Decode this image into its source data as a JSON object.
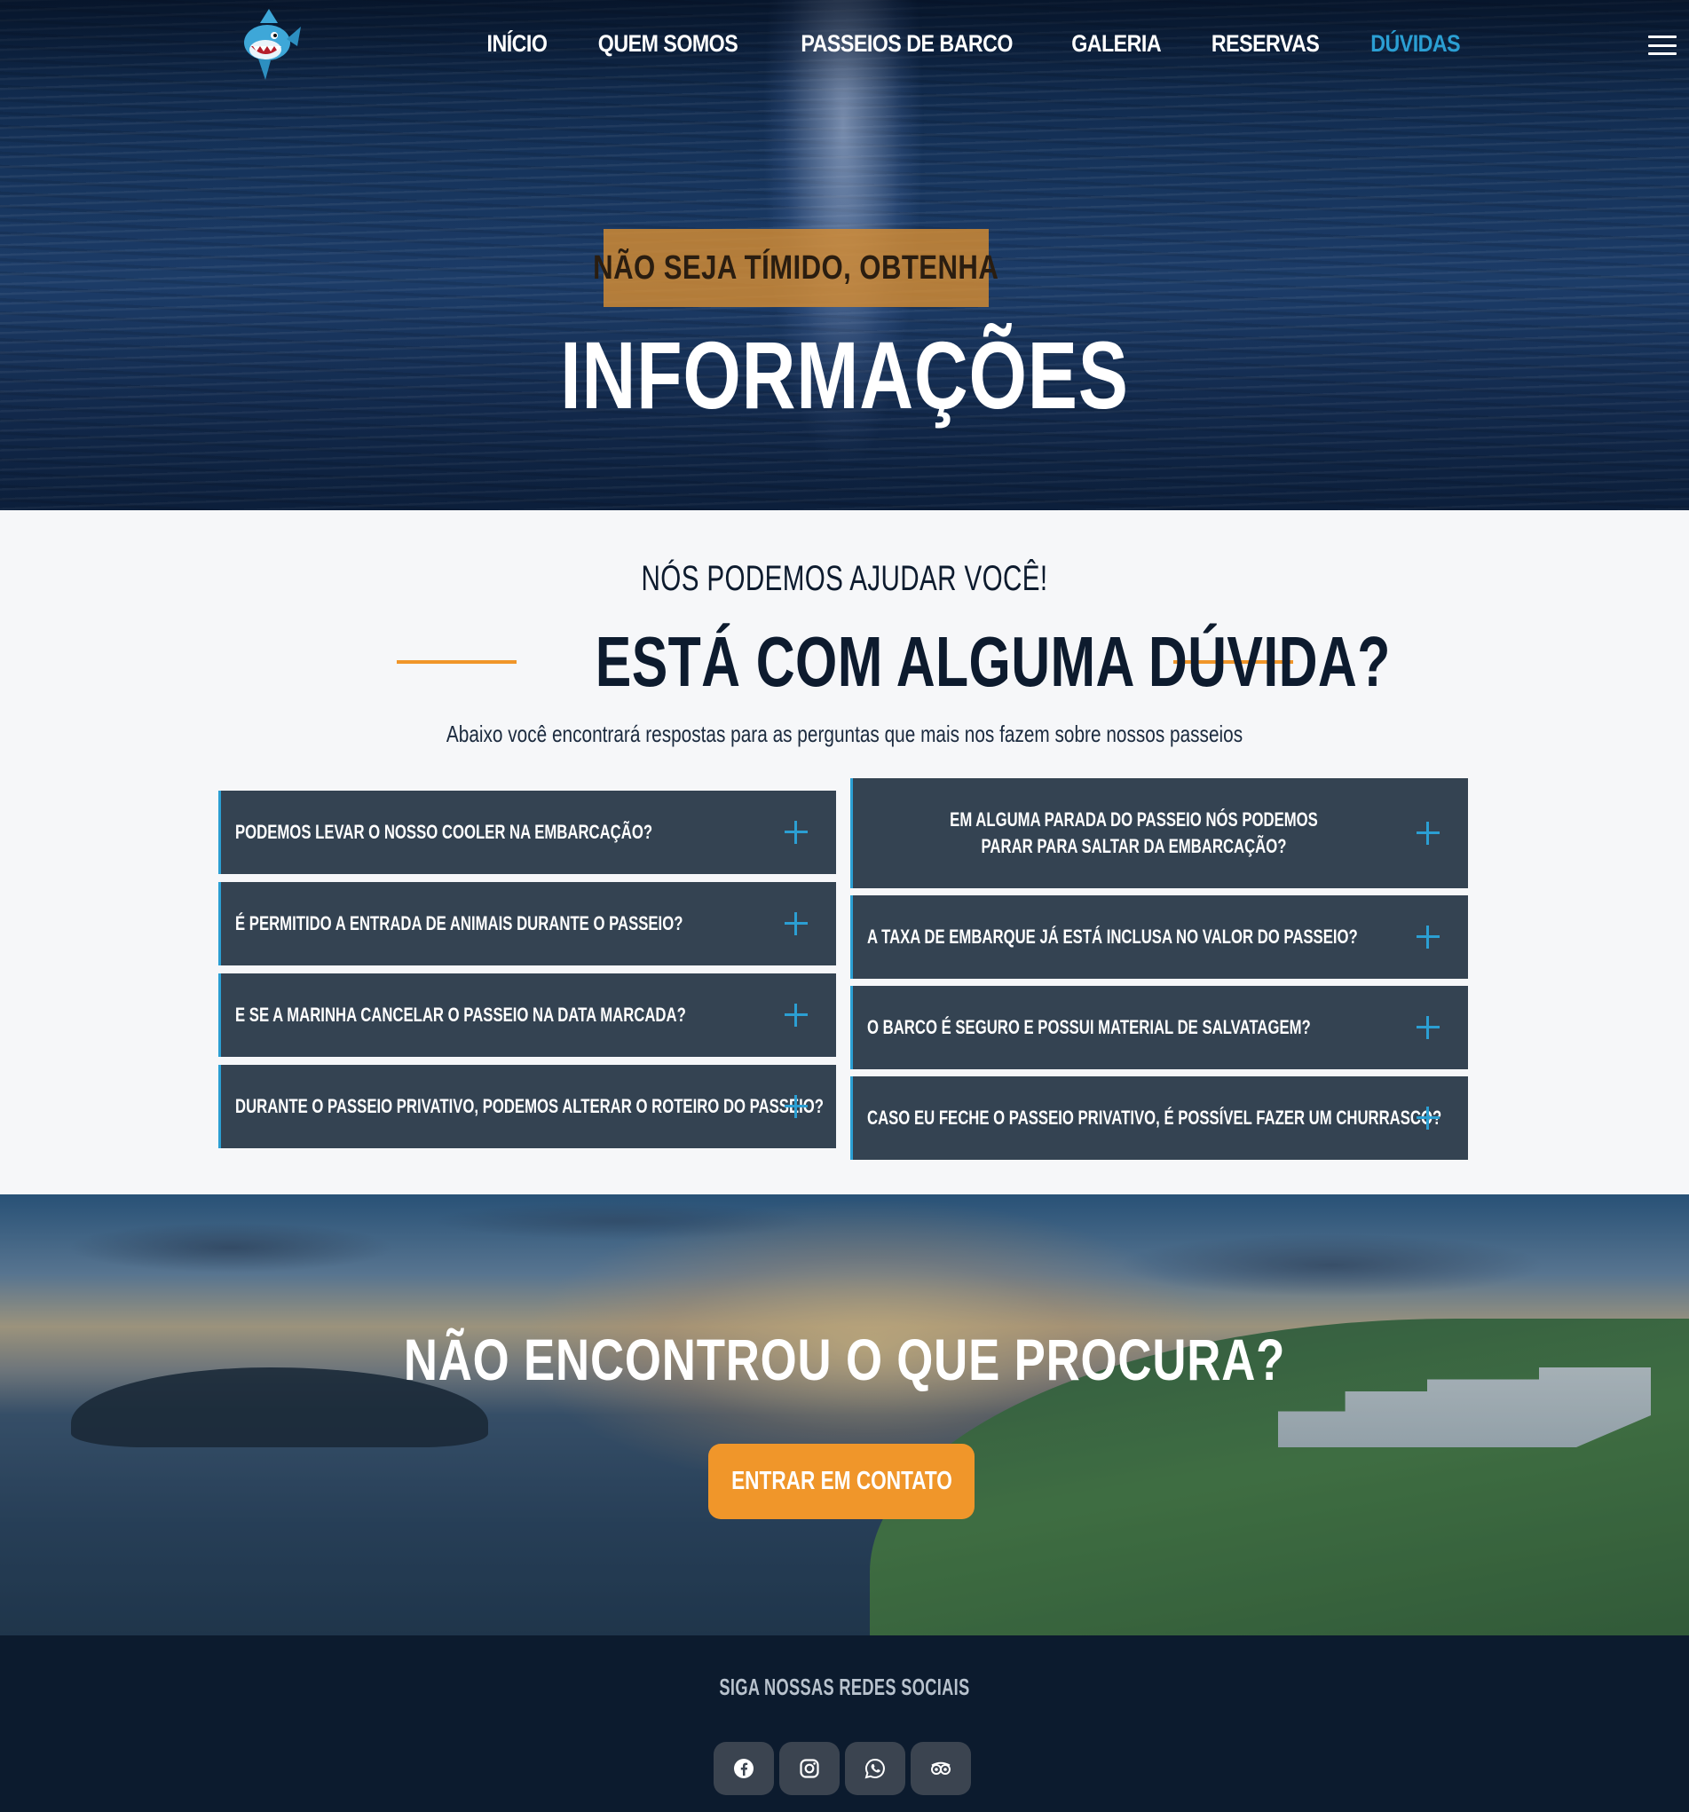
{
  "nav": {
    "items": [
      {
        "label": "INÍCIO"
      },
      {
        "label": "QUEM SOMOS"
      },
      {
        "label": "PASSEIOS DE BARCO"
      },
      {
        "label": "GALERIA"
      },
      {
        "label": "RESERVAS"
      },
      {
        "label": "DÚVIDAS",
        "active": true
      }
    ],
    "active_color": "#2b9fd3"
  },
  "hero": {
    "badge": "NÃO SEJA TÍMIDO, OBTENHA",
    "title": "INFORMAÇÕES"
  },
  "faq": {
    "kicker": "NÓS PODEMOS AJUDAR VOCÊ!",
    "title": "ESTÁ COM ALGUMA DÚVIDA?",
    "subtitle": "Abaixo você encontrará respostas para as perguntas que mais nos fazem sobre nossos passeios",
    "left": [
      {
        "question": "PODEMOS LEVAR O NOSSO COOLER NA EMBARCAÇÃO?"
      },
      {
        "question": "É PERMITIDO A ENTRADA DE ANIMAIS DURANTE O PASSEIO?"
      },
      {
        "question": "E SE A MARINHA CANCELAR O PASSEIO NA DATA MARCADA?"
      },
      {
        "question": "DURANTE O PASSEIO PRIVATIVO, PODEMOS ALTERAR O ROTEIRO DO PASSEIO?"
      }
    ],
    "right": [
      {
        "question": "EM ALGUMA PARADA DO PASSEIO NÓS PODEMOS PARAR PARA SALTAR DA EMBARCAÇÃO?"
      },
      {
        "question": "A TAXA DE EMBARQUE JÁ ESTÁ INCLUSA NO VALOR DO PASSEIO?"
      },
      {
        "question": "O BARCO É SEGURO E POSSUI MATERIAL DE SALVATAGEM?"
      },
      {
        "question": "CASO EU FECHE O PASSEIO PRIVATIVO, É POSSÍVEL FAZER UM CHURRASCO?"
      }
    ],
    "accent_color": "#f0962a",
    "item_color": "#344352"
  },
  "cta": {
    "title": "NÃO ENCONTROU O QUE PROCURA?",
    "button": "ENTRAR EM CONTATO",
    "button_color": "#f0962a"
  },
  "footer": {
    "title": "SIGA NOSSAS REDES SOCIAIS",
    "social": [
      {
        "icon": "facebook-icon"
      },
      {
        "icon": "instagram-icon"
      },
      {
        "icon": "whatsapp-icon"
      },
      {
        "icon": "tripadvisor-icon"
      }
    ]
  }
}
